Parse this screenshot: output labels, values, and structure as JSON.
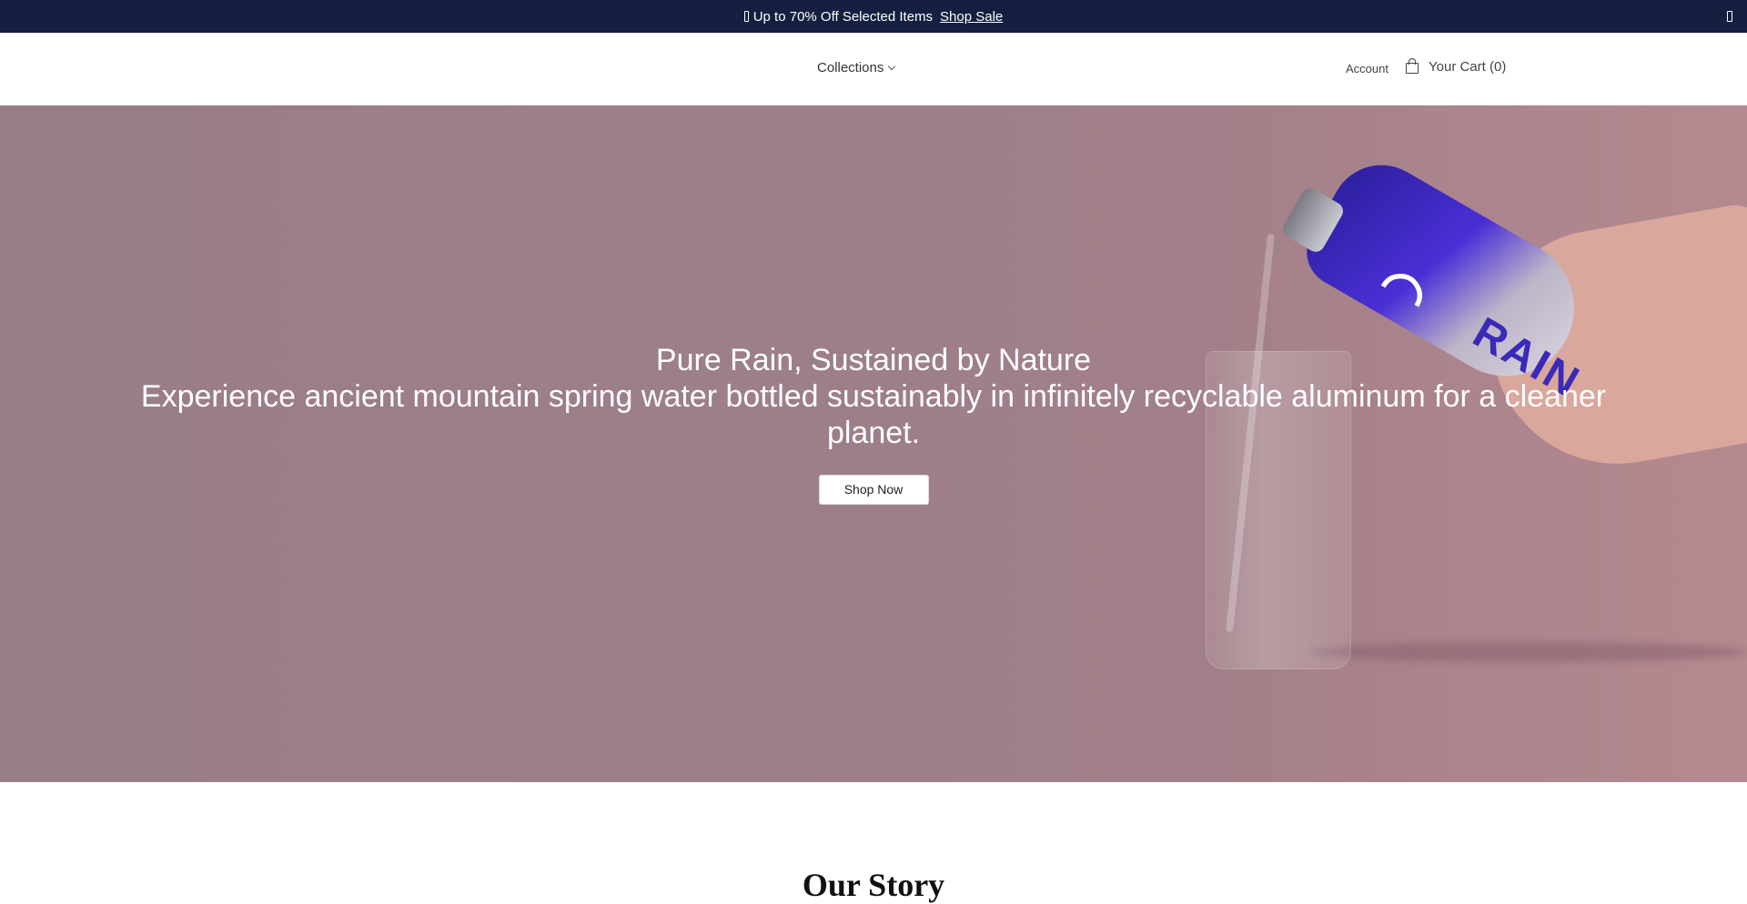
{
  "announcement": {
    "text": "Up to 70% Off Selected Items",
    "link_label": "Shop Sale",
    "tag_icon": "tag-icon",
    "close_icon": "close-icon"
  },
  "header": {
    "nav_collections": "Collections",
    "account_label": "Account",
    "cart_label": "Your Cart (0)",
    "cart_icon": "bag-icon"
  },
  "hero": {
    "title": "Pure Rain, Sustained by Nature",
    "subtitle": "Experience ancient mountain spring water bottled sustainably in infinitely recyclable aluminum for a cleaner planet.",
    "button_label": "Shop Now",
    "bottle_brand": "RAIN"
  },
  "story": {
    "heading": "Our Story"
  },
  "colors": {
    "announcement_bg": "#152040",
    "hero_overlay": "#9a7e87",
    "accent_bottle": "#3a2ab8"
  }
}
